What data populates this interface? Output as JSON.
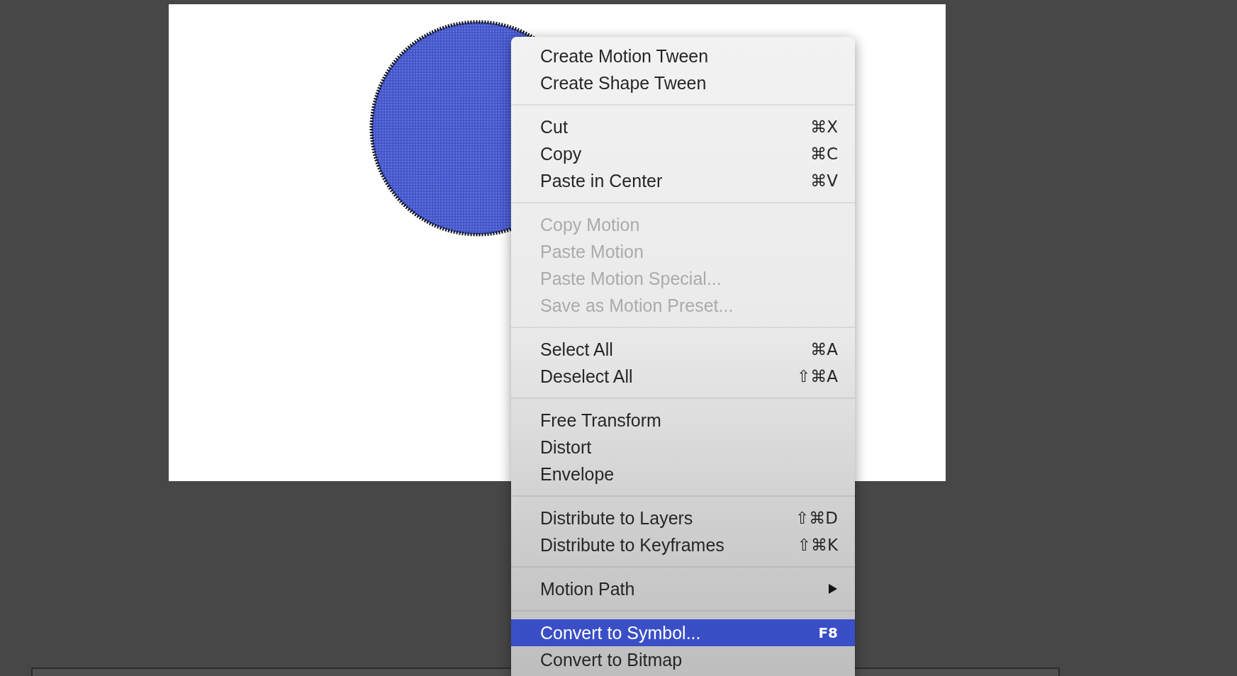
{
  "context_menu": {
    "groups": [
      {
        "items": [
          {
            "label": "Create Motion Tween",
            "disabled": false,
            "selected": false,
            "submenu": false
          },
          {
            "label": "Create Shape Tween",
            "disabled": false,
            "selected": false,
            "submenu": false
          }
        ]
      },
      {
        "items": [
          {
            "label": "Cut",
            "shortcut": "⌘X",
            "disabled": false,
            "selected": false,
            "submenu": false
          },
          {
            "label": "Copy",
            "shortcut": "⌘C",
            "disabled": false,
            "selected": false,
            "submenu": false
          },
          {
            "label": "Paste in Center",
            "shortcut": "⌘V",
            "disabled": false,
            "selected": false,
            "submenu": false
          }
        ]
      },
      {
        "items": [
          {
            "label": "Copy Motion",
            "disabled": true,
            "selected": false,
            "submenu": false
          },
          {
            "label": "Paste Motion",
            "disabled": true,
            "selected": false,
            "submenu": false
          },
          {
            "label": "Paste Motion Special...",
            "disabled": true,
            "selected": false,
            "submenu": false
          },
          {
            "label": "Save as Motion Preset...",
            "disabled": true,
            "selected": false,
            "submenu": false
          }
        ]
      },
      {
        "items": [
          {
            "label": "Select All",
            "shortcut": "⌘A",
            "disabled": false,
            "selected": false,
            "submenu": false
          },
          {
            "label": "Deselect All",
            "shortcut": "⇧⌘A",
            "disabled": false,
            "selected": false,
            "submenu": false
          }
        ]
      },
      {
        "items": [
          {
            "label": "Free Transform",
            "disabled": false,
            "selected": false,
            "submenu": false
          },
          {
            "label": "Distort",
            "disabled": false,
            "selected": false,
            "submenu": false
          },
          {
            "label": "Envelope",
            "disabled": false,
            "selected": false,
            "submenu": false
          }
        ]
      },
      {
        "items": [
          {
            "label": "Distribute to Layers",
            "shortcut": "⇧⌘D",
            "disabled": false,
            "selected": false,
            "submenu": false
          },
          {
            "label": "Distribute to Keyframes",
            "shortcut": "⇧⌘K",
            "disabled": false,
            "selected": false,
            "submenu": false
          }
        ]
      },
      {
        "items": [
          {
            "label": "Motion Path",
            "disabled": false,
            "selected": false,
            "submenu": true
          }
        ]
      },
      {
        "items": [
          {
            "label": "Convert to Symbol...",
            "shortcut": "F8",
            "disabled": false,
            "selected": true,
            "submenu": false
          },
          {
            "label": "Convert to Bitmap",
            "disabled": false,
            "selected": false,
            "submenu": false
          }
        ]
      }
    ]
  }
}
